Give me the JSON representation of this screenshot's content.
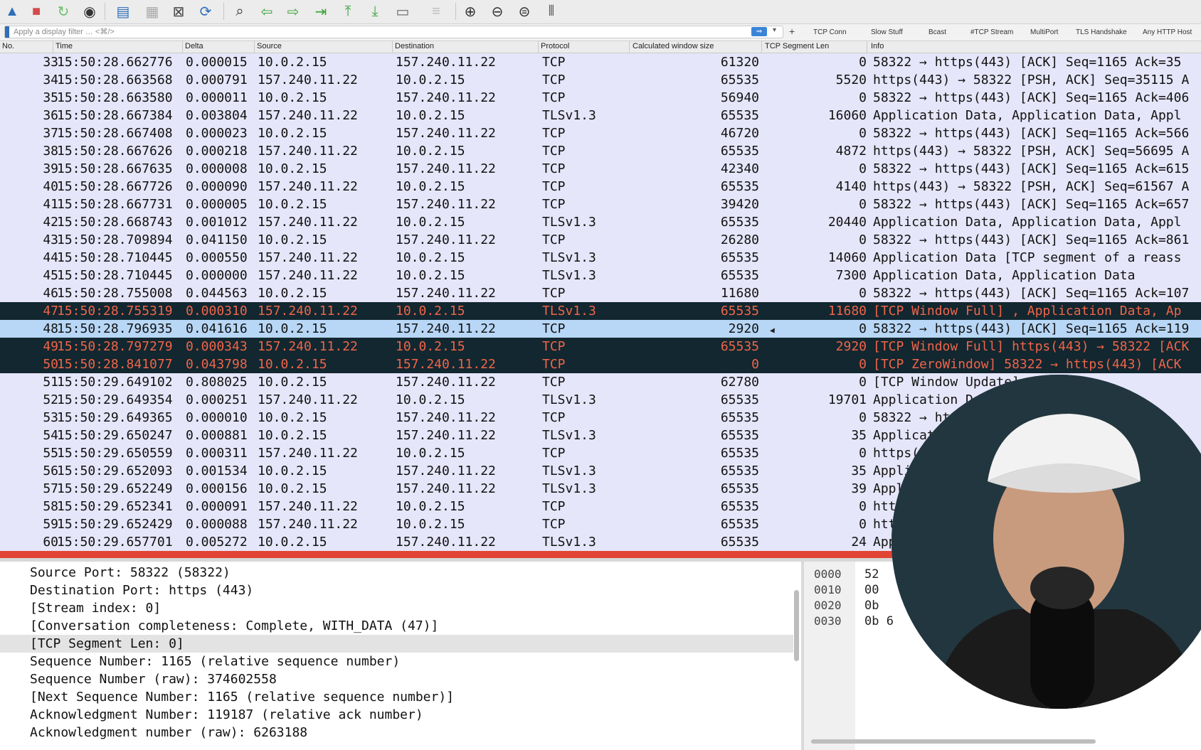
{
  "filter": {
    "placeholder": "Apply a display filter … <⌘/>",
    "apply_arrow": "⇒",
    "buttons": [
      "TCP Conn",
      "Slow Stuff",
      "Bcast",
      "#TCP Stream",
      "MultiPort",
      "TLS Handshake",
      "Any HTTP Host"
    ]
  },
  "columns": {
    "no": "No.",
    "time": "Time",
    "delta": "Delta",
    "source": "Source",
    "destination": "Destination",
    "protocol": "Protocol",
    "window": "Calculated window size",
    "seglen": "TCP Segment Len",
    "info": "Info"
  },
  "packets": [
    {
      "no": "33",
      "time": "15:50:28.662776",
      "delta": "0.000015",
      "src": "10.0.2.15",
      "dst": "157.240.11.22",
      "proto": "TCP",
      "win": "61320",
      "seg": "0",
      "info": "58322 → https(443) [ACK] Seq=1165 Ack=35",
      "style": "normal"
    },
    {
      "no": "34",
      "time": "15:50:28.663568",
      "delta": "0.000791",
      "src": "157.240.11.22",
      "dst": "10.0.2.15",
      "proto": "TCP",
      "win": "65535",
      "seg": "5520",
      "info": "https(443) → 58322 [PSH, ACK] Seq=35115 A",
      "style": "normal"
    },
    {
      "no": "35",
      "time": "15:50:28.663580",
      "delta": "0.000011",
      "src": "10.0.2.15",
      "dst": "157.240.11.22",
      "proto": "TCP",
      "win": "56940",
      "seg": "0",
      "info": "58322 → https(443) [ACK] Seq=1165 Ack=406",
      "style": "normal"
    },
    {
      "no": "36",
      "time": "15:50:28.667384",
      "delta": "0.003804",
      "src": "157.240.11.22",
      "dst": "10.0.2.15",
      "proto": "TLSv1.3",
      "win": "65535",
      "seg": "16060",
      "info": "Application Data, Application Data, Appl",
      "style": "normal"
    },
    {
      "no": "37",
      "time": "15:50:28.667408",
      "delta": "0.000023",
      "src": "10.0.2.15",
      "dst": "157.240.11.22",
      "proto": "TCP",
      "win": "46720",
      "seg": "0",
      "info": "58322 → https(443) [ACK] Seq=1165 Ack=566",
      "style": "normal"
    },
    {
      "no": "38",
      "time": "15:50:28.667626",
      "delta": "0.000218",
      "src": "157.240.11.22",
      "dst": "10.0.2.15",
      "proto": "TCP",
      "win": "65535",
      "seg": "4872",
      "info": "https(443) → 58322 [PSH, ACK] Seq=56695 A",
      "style": "normal"
    },
    {
      "no": "39",
      "time": "15:50:28.667635",
      "delta": "0.000008",
      "src": "10.0.2.15",
      "dst": "157.240.11.22",
      "proto": "TCP",
      "win": "42340",
      "seg": "0",
      "info": "58322 → https(443) [ACK] Seq=1165 Ack=615",
      "style": "normal"
    },
    {
      "no": "40",
      "time": "15:50:28.667726",
      "delta": "0.000090",
      "src": "157.240.11.22",
      "dst": "10.0.2.15",
      "proto": "TCP",
      "win": "65535",
      "seg": "4140",
      "info": "https(443) → 58322 [PSH, ACK] Seq=61567 A",
      "style": "normal"
    },
    {
      "no": "41",
      "time": "15:50:28.667731",
      "delta": "0.000005",
      "src": "10.0.2.15",
      "dst": "157.240.11.22",
      "proto": "TCP",
      "win": "39420",
      "seg": "0",
      "info": "58322 → https(443) [ACK] Seq=1165 Ack=657",
      "style": "normal"
    },
    {
      "no": "42",
      "time": "15:50:28.668743",
      "delta": "0.001012",
      "src": "157.240.11.22",
      "dst": "10.0.2.15",
      "proto": "TLSv1.3",
      "win": "65535",
      "seg": "20440",
      "info": "Application Data, Application Data, Appl",
      "style": "normal"
    },
    {
      "no": "43",
      "time": "15:50:28.709894",
      "delta": "0.041150",
      "src": "10.0.2.15",
      "dst": "157.240.11.22",
      "proto": "TCP",
      "win": "26280",
      "seg": "0",
      "info": "58322 → https(443) [ACK] Seq=1165 Ack=861",
      "style": "normal"
    },
    {
      "no": "44",
      "time": "15:50:28.710445",
      "delta": "0.000550",
      "src": "157.240.11.22",
      "dst": "10.0.2.15",
      "proto": "TLSv1.3",
      "win": "65535",
      "seg": "14060",
      "info": "Application Data [TCP segment of a reass",
      "style": "normal"
    },
    {
      "no": "45",
      "time": "15:50:28.710445",
      "delta": "0.000000",
      "src": "157.240.11.22",
      "dst": "10.0.2.15",
      "proto": "TLSv1.3",
      "win": "65535",
      "seg": "7300",
      "info": "Application Data, Application Data",
      "style": "normal"
    },
    {
      "no": "46",
      "time": "15:50:28.755008",
      "delta": "0.044563",
      "src": "10.0.2.15",
      "dst": "157.240.11.22",
      "proto": "TCP",
      "win": "11680",
      "seg": "0",
      "info": "58322 → https(443) [ACK] Seq=1165 Ack=107",
      "style": "normal"
    },
    {
      "no": "47",
      "time": "15:50:28.755319",
      "delta": "0.000310",
      "src": "157.240.11.22",
      "dst": "10.0.2.15",
      "proto": "TLSv1.3",
      "win": "65535",
      "seg": "11680",
      "info": "[TCP Window Full] , Application Data, Ap",
      "style": "bad"
    },
    {
      "no": "48",
      "time": "15:50:28.796935",
      "delta": "0.041616",
      "src": "10.0.2.15",
      "dst": "157.240.11.22",
      "proto": "TCP",
      "win": "2920",
      "seg": "0",
      "info": "58322 → https(443) [ACK] Seq=1165 Ack=119",
      "style": "sel"
    },
    {
      "no": "49",
      "time": "15:50:28.797279",
      "delta": "0.000343",
      "src": "157.240.11.22",
      "dst": "10.0.2.15",
      "proto": "TCP",
      "win": "65535",
      "seg": "2920",
      "info": "[TCP Window Full] https(443) → 58322 [ACK",
      "style": "bad"
    },
    {
      "no": "50",
      "time": "15:50:28.841077",
      "delta": "0.043798",
      "src": "10.0.2.15",
      "dst": "157.240.11.22",
      "proto": "TCP",
      "win": "0",
      "seg": "0",
      "info": "[TCP ZeroWindow] 58322 → https(443) [ACK",
      "style": "bad"
    },
    {
      "no": "51",
      "time": "15:50:29.649102",
      "delta": "0.808025",
      "src": "10.0.2.15",
      "dst": "157.240.11.22",
      "proto": "TCP",
      "win": "62780",
      "seg": "0",
      "info": "[TCP Window Update]",
      "style": "normal"
    },
    {
      "no": "52",
      "time": "15:50:29.649354",
      "delta": "0.000251",
      "src": "157.240.11.22",
      "dst": "10.0.2.15",
      "proto": "TLSv1.3",
      "win": "65535",
      "seg": "19701",
      "info": "Application Da",
      "style": "normal"
    },
    {
      "no": "53",
      "time": "15:50:29.649365",
      "delta": "0.000010",
      "src": "10.0.2.15",
      "dst": "157.240.11.22",
      "proto": "TCP",
      "win": "65535",
      "seg": "0",
      "info": "58322 → htt",
      "style": "normal"
    },
    {
      "no": "54",
      "time": "15:50:29.650247",
      "delta": "0.000881",
      "src": "10.0.2.15",
      "dst": "157.240.11.22",
      "proto": "TLSv1.3",
      "win": "65535",
      "seg": "35",
      "info": "Applicati",
      "style": "normal"
    },
    {
      "no": "55",
      "time": "15:50:29.650559",
      "delta": "0.000311",
      "src": "157.240.11.22",
      "dst": "10.0.2.15",
      "proto": "TCP",
      "win": "65535",
      "seg": "0",
      "info": "https(4",
      "style": "normal"
    },
    {
      "no": "56",
      "time": "15:50:29.652093",
      "delta": "0.001534",
      "src": "10.0.2.15",
      "dst": "157.240.11.22",
      "proto": "TLSv1.3",
      "win": "65535",
      "seg": "35",
      "info": "Appli",
      "style": "normal"
    },
    {
      "no": "57",
      "time": "15:50:29.652249",
      "delta": "0.000156",
      "src": "10.0.2.15",
      "dst": "157.240.11.22",
      "proto": "TLSv1.3",
      "win": "65535",
      "seg": "39",
      "info": "Appl",
      "style": "normal"
    },
    {
      "no": "58",
      "time": "15:50:29.652341",
      "delta": "0.000091",
      "src": "157.240.11.22",
      "dst": "10.0.2.15",
      "proto": "TCP",
      "win": "65535",
      "seg": "0",
      "info": "htt",
      "style": "normal"
    },
    {
      "no": "59",
      "time": "15:50:29.652429",
      "delta": "0.000088",
      "src": "157.240.11.22",
      "dst": "10.0.2.15",
      "proto": "TCP",
      "win": "65535",
      "seg": "0",
      "info": "htt",
      "style": "normal"
    },
    {
      "no": "60",
      "time": "15:50:29.657701",
      "delta": "0.005272",
      "src": "10.0.2.15",
      "dst": "157.240.11.22",
      "proto": "TLSv1.3",
      "win": "65535",
      "seg": "24",
      "info": "App",
      "style": "normal"
    }
  ],
  "details": [
    "Source Port: 58322 (58322)",
    "Destination Port: https (443)",
    "[Stream index: 0]",
    "[Conversation completeness: Complete, WITH_DATA (47)]",
    "[TCP Segment Len: 0]",
    "Sequence Number: 1165    (relative sequence number)",
    "Sequence Number (raw): 374602558",
    "[Next Sequence Number: 1165    (relative sequence number)]",
    "Acknowledgment Number: 119187    (relative ack number)",
    "Acknowledgment number (raw): 6263188"
  ],
  "hex": {
    "offsets": [
      "0000",
      "0010",
      "0020",
      "0030"
    ],
    "bytes": [
      "52",
      "00",
      "0b",
      "0b 6"
    ]
  }
}
